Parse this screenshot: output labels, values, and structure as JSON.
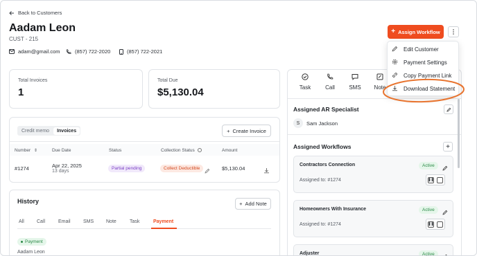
{
  "nav": {
    "back_label": "Back to Customers"
  },
  "customer": {
    "name": "Aadam Leon",
    "id": "CUST - 215",
    "email": "adam@gmail.com",
    "phone": "(857) 722-2020",
    "mobile": "(857) 722-2021"
  },
  "header_actions": {
    "assign_workflow_label": "Assign Workflow"
  },
  "menu": {
    "items": [
      "Edit Customer",
      "Payment Settings",
      "Copy Payment Link",
      "Download Statement"
    ]
  },
  "stats": {
    "total_invoices_label": "Total Invoices",
    "total_invoices_value": "1",
    "total_due_label": "Total Due",
    "total_due_value": "$5,130.04"
  },
  "invoices": {
    "segments": [
      "Credit memo",
      "Invoices"
    ],
    "active_segment": "Invoices",
    "create_label": "Create Invoice",
    "columns": [
      "Number",
      "Due Date",
      "Status",
      "Collection Status",
      "Amount"
    ],
    "rows": [
      {
        "number": "#1274",
        "due_date": "Apr 22, 2025",
        "due_sub": "13 days",
        "status": "Partial pending",
        "collection_status": "Collect Deductible",
        "amount": "$5,130.04"
      }
    ]
  },
  "history": {
    "title": "History",
    "add_note_label": "Add Note",
    "tabs": [
      "All",
      "Call",
      "Email",
      "SMS",
      "Note",
      "Task",
      "Payment"
    ],
    "active_tab": "Payment",
    "entry_badge": "Payment",
    "entry_name": "Aadam Leon"
  },
  "actions": {
    "items": [
      "Task",
      "Call",
      "SMS",
      "Note"
    ]
  },
  "ar_specialist": {
    "title": "Assigned AR Specialist",
    "initial": "S",
    "name": "Sam Jackson"
  },
  "workflows": {
    "title": "Assigned Workflows",
    "items": [
      {
        "name": "Contractors Connection",
        "status": "Active",
        "assigned": "Assigned to: #1274"
      },
      {
        "name": "Homeowners With Insurance",
        "status": "Active",
        "assigned": "Assigned to: #1274"
      },
      {
        "name": "Adjuster",
        "status": "Active",
        "assigned": ""
      }
    ]
  },
  "colors": {
    "accent": "#ef4c1f",
    "highlight_ring": "#e8742f",
    "active_green": "#2b8a47"
  }
}
